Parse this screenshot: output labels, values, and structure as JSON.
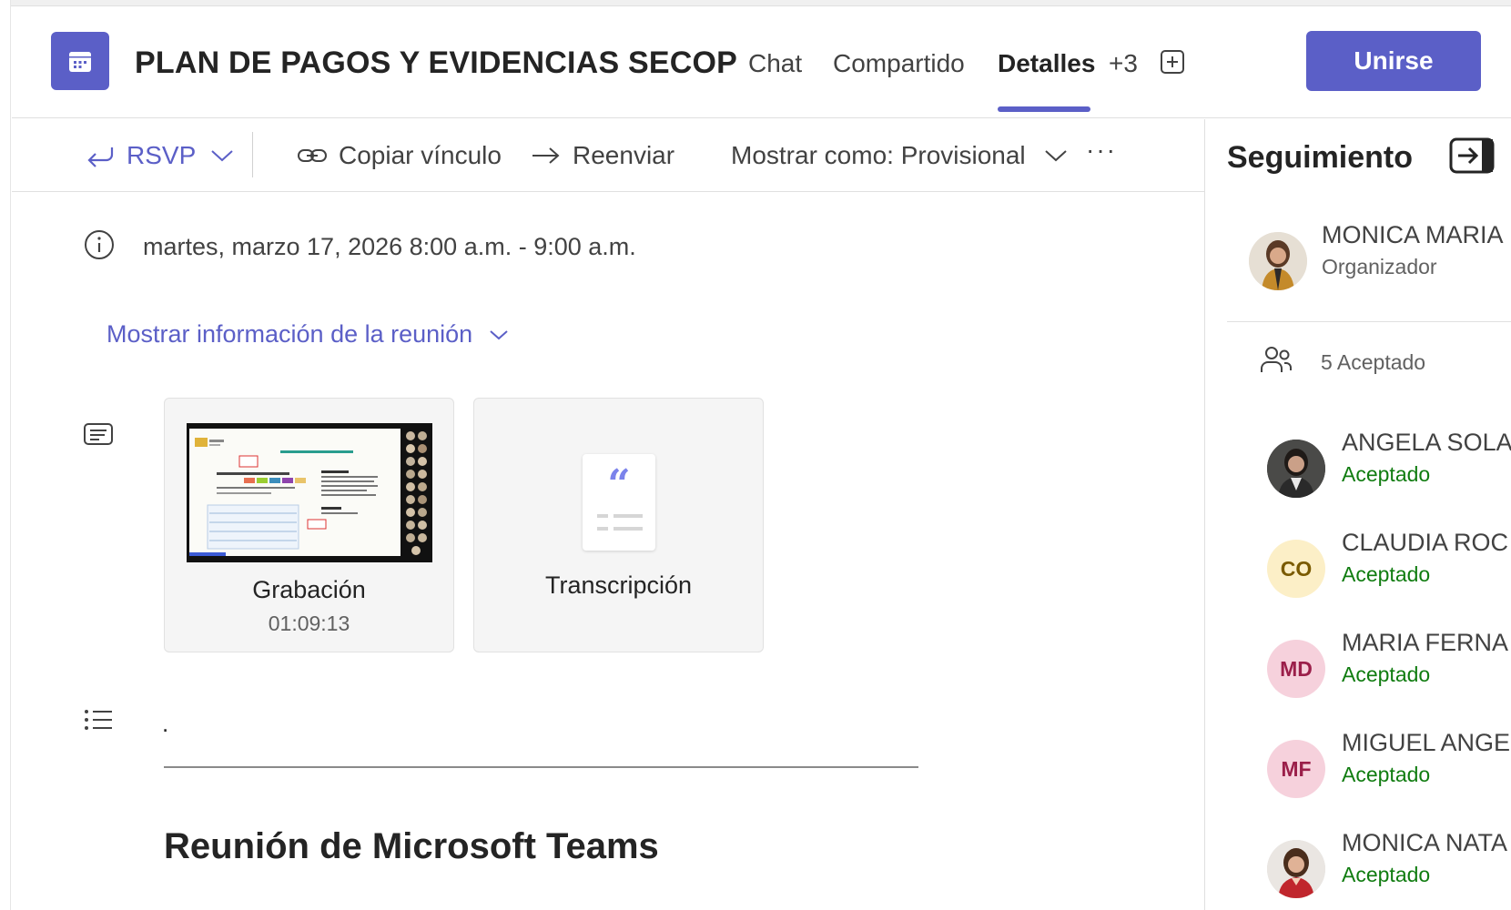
{
  "header": {
    "title": "PLAN DE PAGOS Y EVIDENCIAS SECOP",
    "tabs": [
      {
        "label": "Chat"
      },
      {
        "label": "Compartido"
      },
      {
        "label": "Detalles"
      },
      {
        "label": "+3"
      }
    ],
    "join_label": "Unirse"
  },
  "toolbar": {
    "rsvp": "RSVP",
    "copy_link": "Copiar vínculo",
    "forward": "Reenviar",
    "show_as": "Mostrar como: Provisional",
    "more": "···"
  },
  "details": {
    "datetime": "martes, marzo 17, 2026 8:00 a.m. - 9:00 a.m.",
    "show_info": "Mostrar información de la reunión",
    "recording_label": "Grabación",
    "recording_duration": "01:09:13",
    "transcript_label": "Transcripción",
    "body_dot": ".",
    "teams_heading": "Reunión de Microsoft Teams"
  },
  "panel": {
    "title": "Seguimiento",
    "organizer_name": "MONICA MARIA",
    "organizer_role": "Organizador",
    "accepted_count": "5 Aceptado",
    "attendees": [
      {
        "name": "ANGELA SOLA",
        "status": "Aceptado",
        "initials": ""
      },
      {
        "name": "CLAUDIA ROC",
        "status": "Aceptado",
        "initials": "CO"
      },
      {
        "name": "MARIA FERNA",
        "status": "Aceptado",
        "initials": "MD"
      },
      {
        "name": "MIGUEL ANGE",
        "status": "Aceptado",
        "initials": "MF"
      },
      {
        "name": "MONICA NATA",
        "status": "Aceptado",
        "initials": ""
      }
    ]
  },
  "colors": {
    "brand": "#5b5fc7",
    "accepted": "#107c10"
  }
}
